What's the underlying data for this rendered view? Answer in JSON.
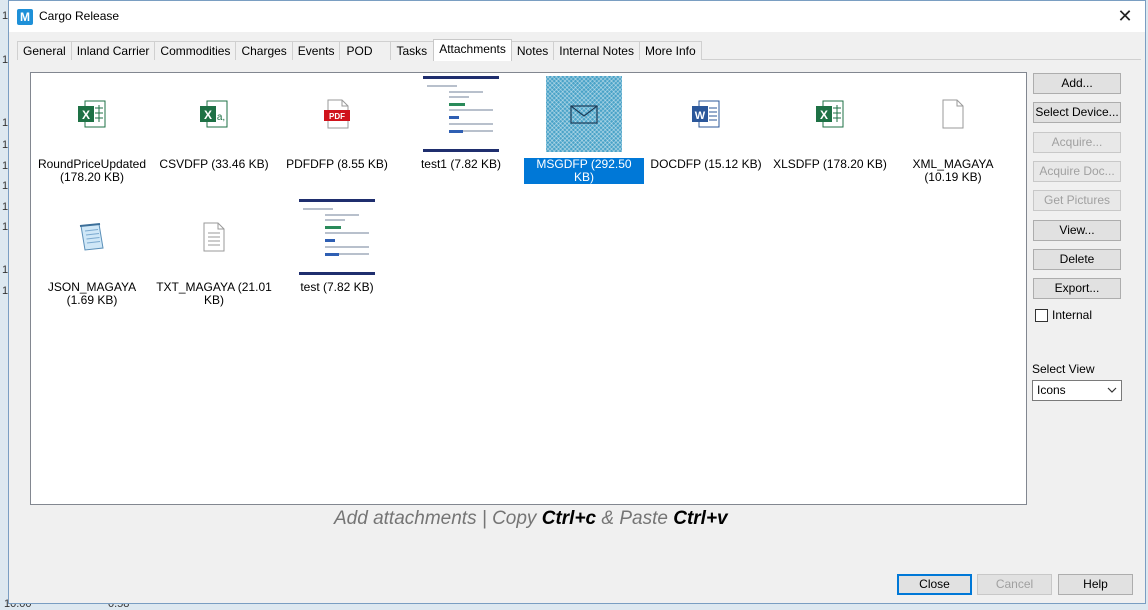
{
  "background": {
    "left_numbers": [
      "1",
      "1",
      "1",
      "1",
      "1",
      "1",
      "1",
      "1",
      "1",
      "1"
    ],
    "bottom_values": [
      "10.00",
      "0.58"
    ]
  },
  "window": {
    "title": "Cargo Release",
    "app_icon_letter": "M",
    "close_glyph": "✕"
  },
  "tabs": [
    {
      "label": "General",
      "active": false
    },
    {
      "label": "Inland Carrier",
      "active": false
    },
    {
      "label": "Commodities",
      "active": false
    },
    {
      "label": "Charges",
      "active": false
    },
    {
      "label": "Events",
      "active": false
    },
    {
      "label": "POD",
      "active": false
    },
    {
      "label": "Tasks",
      "active": false
    },
    {
      "label": "Attachments",
      "active": true
    },
    {
      "label": "Notes",
      "active": false
    },
    {
      "label": "Internal Notes",
      "active": false
    },
    {
      "label": "More Info",
      "active": false
    }
  ],
  "attachments": [
    {
      "label": "RoundPriceUpdated (178.20 KB)",
      "icon": "excel-icon",
      "selected": false
    },
    {
      "label": "CSVDFP (33.46 KB)",
      "icon": "csv-excel-icon",
      "selected": false
    },
    {
      "label": "PDFDFP (8.55 KB)",
      "icon": "pdf-icon",
      "selected": false
    },
    {
      "label": "test1 (7.82 KB)",
      "icon": "screenshot-thumbnail",
      "selected": false
    },
    {
      "label": "MSGDFP (292.50 KB)",
      "icon": "envelope-icon",
      "selected": true
    },
    {
      "label": "DOCDFP (15.12 KB)",
      "icon": "word-icon",
      "selected": false
    },
    {
      "label": "XLSDFP (178.20 KB)",
      "icon": "excel-icon",
      "selected": false
    },
    {
      "label": "XML_MAGAYA (10.19 KB)",
      "icon": "blank-file-icon",
      "selected": false
    },
    {
      "label": "JSON_MAGAYA (1.69 KB)",
      "icon": "notepad-icon",
      "selected": false
    },
    {
      "label": "TXT_MAGAYA (21.01 KB)",
      "icon": "text-file-icon",
      "selected": false
    },
    {
      "label": "test (7.82 KB)",
      "icon": "screenshot-thumbnail",
      "selected": false
    }
  ],
  "sidebar": {
    "add": "Add...",
    "select_device": "Select Device...",
    "acquire": "Acquire...",
    "acquire_doc": "Acquire Doc...",
    "get_pictures": "Get Pictures",
    "view": "View...",
    "delete": "Delete",
    "export": "Export...",
    "internal_label": "Internal",
    "internal_checked": false,
    "select_view_label": "Select View",
    "select_view_value": "Icons"
  },
  "hint": {
    "part1": "Add attachments | Copy ",
    "key1": "Ctrl+c",
    "part2": " & Paste ",
    "key2": "Ctrl+v"
  },
  "footer": {
    "close": "Close",
    "cancel": "Cancel",
    "help": "Help"
  },
  "colors": {
    "selection": "#0078d7",
    "excel_green": "#1e7145",
    "word_blue": "#2b579a",
    "pdf_red": "#d0121b"
  }
}
